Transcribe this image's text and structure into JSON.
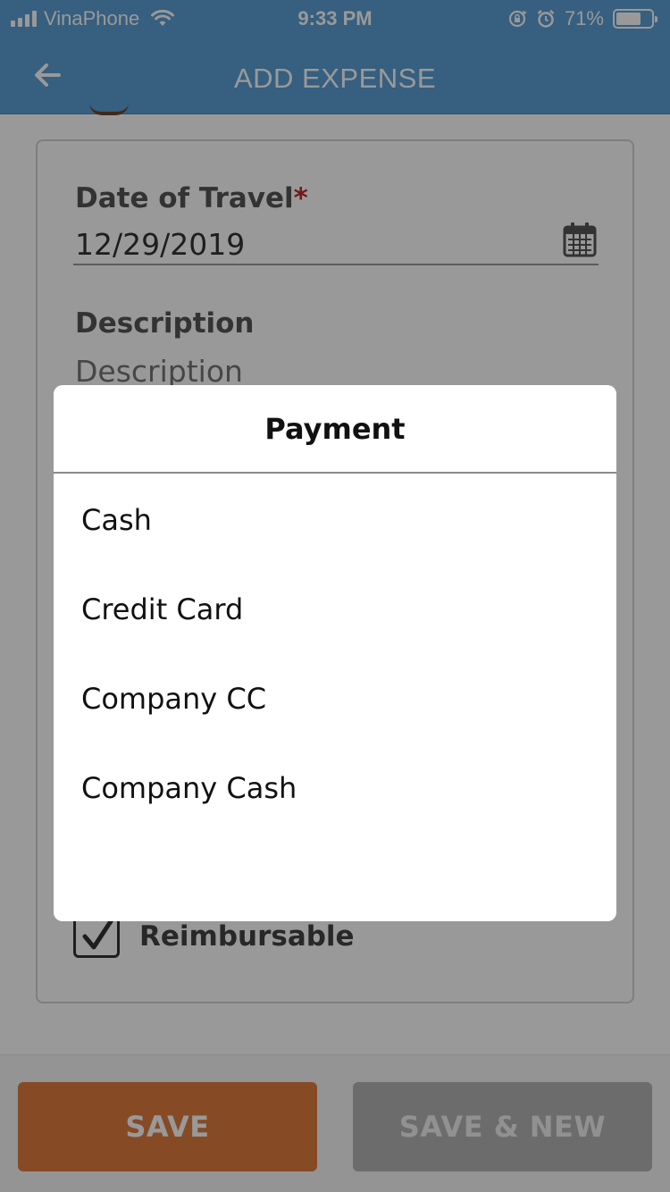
{
  "status_bar": {
    "carrier": "VinaPhone",
    "time": "9:33 PM",
    "battery_percent": "71%",
    "battery_level": 0.71,
    "icons": [
      "signal-icon",
      "wifi-icon",
      "rotation-lock-icon",
      "alarm-icon",
      "battery-icon"
    ]
  },
  "header": {
    "title": "ADD EXPENSE",
    "back_icon": "arrow-left-icon",
    "color": "#5a9fd6"
  },
  "form": {
    "date": {
      "label": "Date of Travel",
      "required_mark": "*",
      "value": "12/29/2019",
      "icon": "calendar-icon"
    },
    "description": {
      "label": "Description",
      "placeholder": "Description"
    },
    "reimbursable": {
      "label": "Reimbursable",
      "checked": true
    }
  },
  "actions": {
    "save_label": "SAVE",
    "save_new_label": "SAVE & NEW",
    "save_color": "#e07d3e",
    "save_new_color": "#b4b4b4"
  },
  "payment_dialog": {
    "title": "Payment",
    "options": [
      "Cash",
      "Credit Card",
      "Company CC",
      "Company Cash"
    ]
  }
}
